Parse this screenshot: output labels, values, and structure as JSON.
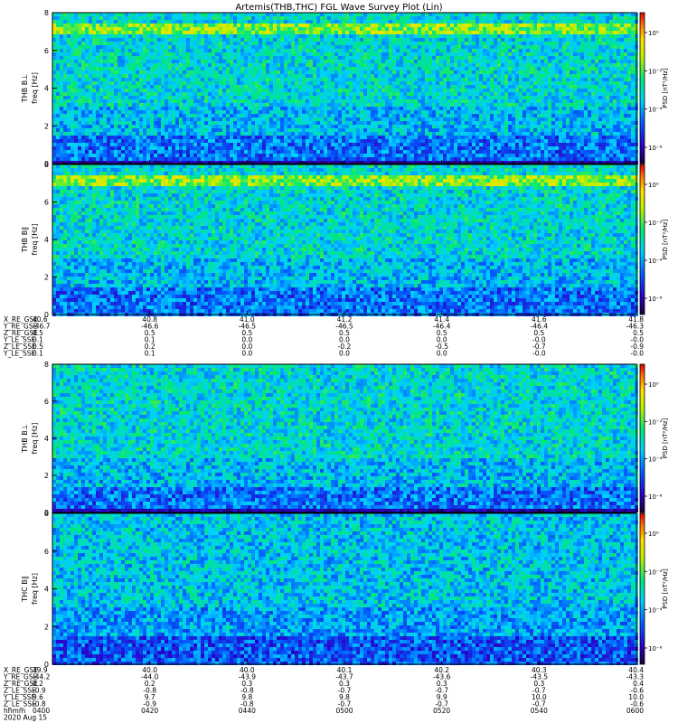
{
  "title": "Artemis(THB,THC) FGL Wave Survey Plot (Lin)",
  "chart_data": [
    {
      "type": "heatmap",
      "name": "THB B⊥",
      "ylabel_line1": "THB B⊥",
      "ylabel_line2": "freq [Hz]",
      "ylim": [
        0,
        8
      ],
      "yticks": [
        "0",
        "2",
        "4",
        "6",
        "8"
      ],
      "colorbar_label": "PSD [nT²/Hz]",
      "colorbar_ticks": [
        "10⁰",
        "10⁻²",
        "10⁻⁴",
        "10⁻⁶"
      ],
      "colorscale": "rainbow",
      "features": {
        "bright_band_hz": [
          6.9,
          7.4
        ],
        "dark_band_hz": [
          0.0,
          0.2
        ]
      }
    },
    {
      "type": "heatmap",
      "name": "THB B∥",
      "ylabel_line1": "THB B∥",
      "ylabel_line2": "freq [Hz]",
      "ylim": [
        0,
        8
      ],
      "yticks": [
        "0",
        "2",
        "4",
        "6",
        "8"
      ],
      "colorbar_label": "PSD [nT²/Hz]",
      "colorbar_ticks": [
        "10⁰",
        "10⁻²",
        "10⁻⁴",
        "10⁻⁶"
      ],
      "colorscale": "rainbow",
      "features": {
        "bright_band_hz": [
          6.9,
          7.4
        ],
        "dark_band_hz": [
          0.0,
          0.0
        ]
      }
    },
    {
      "type": "heatmap",
      "name": "THB B⊥ (THC)",
      "ylabel_line1": "THB B⊥",
      "ylabel_line2": "freq [Hz]",
      "ylim": [
        0,
        8
      ],
      "yticks": [
        "0",
        "2",
        "4",
        "6",
        "8"
      ],
      "colorbar_label": "PSD [nT²/Hz]",
      "colorbar_ticks": [
        "10⁰",
        "10⁻²",
        "10⁻⁴",
        "10⁻⁶"
      ],
      "colorscale": "rainbow",
      "features": {
        "bright_band_hz": [
          0,
          0
        ],
        "dark_band_hz": [
          0.0,
          0.2
        ]
      }
    },
    {
      "type": "heatmap",
      "name": "THC B∥",
      "ylabel_line1": "THC B∥",
      "ylabel_line2": "freq [Hz]",
      "ylim": [
        0,
        8
      ],
      "yticks": [
        "0",
        "2",
        "4",
        "6",
        "8"
      ],
      "colorbar_label": "PSD [nT²/Hz]",
      "colorbar_ticks": [
        "10⁰",
        "10⁻²",
        "10⁻⁴",
        "10⁻⁶"
      ],
      "colorscale": "rainbow",
      "features": {
        "bright_band_hz": [
          0,
          0
        ],
        "dark_band_hz": [
          0.0,
          0.0
        ]
      }
    }
  ],
  "ephemeris_thb": {
    "rows": [
      {
        "label": "X_RE_GSE",
        "values": [
          "40.6",
          "40.8",
          "41.0",
          "41.2",
          "41.4",
          "41.6",
          "41.8"
        ]
      },
      {
        "label": "Y_RE_GSE",
        "values": [
          "-46.7",
          "-46.6",
          "-46.5",
          "-46.5",
          "-46.4",
          "-46.4",
          "-46.3"
        ]
      },
      {
        "label": "Z_RE_GSE",
        "values": [
          "0.5",
          "0.5",
          "0.5",
          "0.5",
          "0.5",
          "0.5",
          "0.5"
        ]
      },
      {
        "label": "Y_LE_SSE",
        "values": [
          "0.1",
          "0.1",
          "0.0",
          "0.0",
          "0.0",
          "-0.0",
          "-0.0"
        ]
      },
      {
        "label": "Z_LE_SSE",
        "values": [
          "0.5",
          "0.2",
          "0.0",
          "-0.2",
          "-0.5",
          "-0.7",
          "-0.9"
        ]
      },
      {
        "label": "Y_LE_SSE",
        "values": [
          "0.1",
          "0.1",
          "0.0",
          "0.0",
          "0.0",
          "-0.0",
          "-0.0"
        ]
      }
    ]
  },
  "ephemeris_thc": {
    "rows": [
      {
        "label": "X_RE_GSE",
        "values": [
          "39.9",
          "40.0",
          "40.0",
          "40.1",
          "40.2",
          "40.3",
          "40.4"
        ]
      },
      {
        "label": "Y_RE_GSE",
        "values": [
          "-44.2",
          "-44.0",
          "-43.9",
          "-43.7",
          "-43.6",
          "-43.5",
          "-43.3"
        ]
      },
      {
        "label": "Z_RE_GSE",
        "values": [
          "0.2",
          "0.2",
          "0.3",
          "0.3",
          "0.3",
          "0.3",
          "0.4"
        ]
      },
      {
        "label": "Z_LE_SSE",
        "values": [
          "-0.9",
          "-0.8",
          "-0.8",
          "-0.7",
          "-0.7",
          "-0.7",
          "-0.6"
        ]
      },
      {
        "label": "Y_LE_SSE",
        "values": [
          "9.6",
          "9.7",
          "9.8",
          "9.8",
          "9.9",
          "10.0",
          "10.0"
        ]
      },
      {
        "label": "Z_LE_SSE",
        "values": [
          "-0.8",
          "-0.9",
          "-0.8",
          "-0.7",
          "-0.7",
          "-0.7",
          "-0.6"
        ]
      },
      {
        "label": "hhmm",
        "values": [
          "0400",
          "0420",
          "0440",
          "0500",
          "0520",
          "0540",
          "0600"
        ]
      }
    ],
    "date": "2020 Aug 15"
  }
}
